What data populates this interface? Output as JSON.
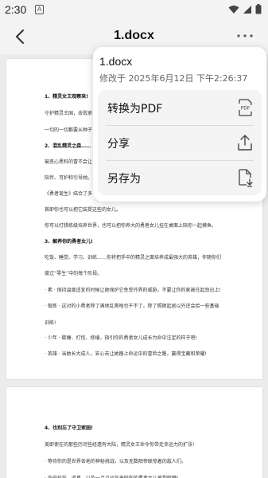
{
  "status": {
    "time": "2:30",
    "notif": "A"
  },
  "header": {
    "title": "1.docx"
  },
  "popup": {
    "title": "1.docx",
    "subtitle": "修改于 2025年6月12日 下午2:26:37",
    "items": [
      {
        "label": "转换为PDF",
        "icon": "pdf-convert-icon",
        "icon_text": "PDF"
      },
      {
        "label": "分享",
        "icon": "share-icon"
      },
      {
        "label": "另存为",
        "icon": "save-as-icon"
      }
    ]
  },
  "document": {
    "page1_lines": [
      "1、精灵女王观察来!",
      "守护精灵王国，击败邪",
      "一切的一切都要从种子",
      "2、混乱精灵之森……",
      "被恶心黑料的冒不会让",
      "陪伴、可护和引导她。",
      "《勇者诞生》结合了多",
      "首即你也可以把它装提这些的女儿。",
      "你可以打猎练级培养世界，也可以把你养大的勇者女儿挂在桌面上陪你一起摸鱼。",
      "3、解养你的勇者女儿!",
      "吃饭、睡觉、学习、训练……你将把手中的精灵之面培养成最强大的英雄，伴随你们",
      "度过“零生”中的每个阶段。",
      "· 素 · 保持温度适宜的时候让她保护它免受外界的威胁，不要让你的家被在起劲迅上!",
      "· 锻炼 · 这对的小勇者除了满地乱爬啥也干不了，除了照顾起居以外还会给一些基础",
      "训练!",
      "· 少年 · 歇睡、打怪、修缮，指引你的勇者女儿成长为命中注定的样子吧!",
      "· 英雄 · 当她长大成人，安心去让她踏上命运中的冒险之路，赢得宝藏和荣耀!"
    ],
    "page1_bold_indices": [
      0,
      3,
      9
    ],
    "page2_lines": [
      "4、也别忘了守卫家园!",
      "美即使在的那些历尽些经遗有大陆，精灵女王命令你带走幸运力的扩张!",
      "· 等待你的是世界各地的神秘挑战，以及无数陌帝联惊着的敌人们。",
      "· 各府挂装，道具，以及一点点运气来陪你的勇者女儿披荆斩棘!"
    ],
    "page2_bold_indices": [
      0
    ]
  }
}
